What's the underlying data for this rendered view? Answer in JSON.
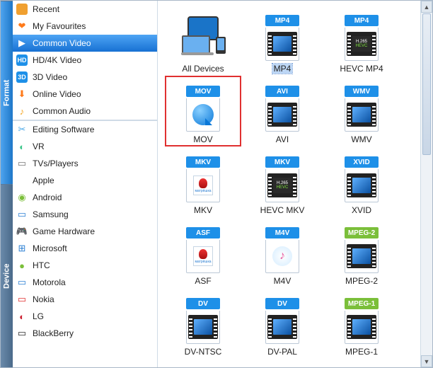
{
  "vtabs": {
    "format": "Format",
    "device": "Device"
  },
  "sidebar_top": [
    {
      "name": "recent",
      "label": "Recent",
      "iconType": "sq",
      "bg": "#f0a030",
      "glyph": ""
    },
    {
      "name": "favourites",
      "label": "My Favourites",
      "iconType": "glyph",
      "color": "#ff7a1a",
      "glyph": "❤"
    },
    {
      "name": "common-video",
      "label": "Common Video",
      "iconType": "glyph",
      "color": "#fff",
      "glyph": "▶",
      "selected": true
    },
    {
      "name": "hd4k",
      "label": "HD/4K Video",
      "iconType": "sq",
      "bg": "#1e90e8",
      "glyph": "HD"
    },
    {
      "name": "3d",
      "label": "3D Video",
      "iconType": "sq",
      "bg": "#1e90e8",
      "glyph": "3D"
    },
    {
      "name": "online",
      "label": "Online Video",
      "iconType": "glyph",
      "color": "#ff7a1a",
      "glyph": "⬇"
    },
    {
      "name": "audio",
      "label": "Common Audio",
      "iconType": "glyph",
      "color": "#f5a623",
      "glyph": "♪"
    }
  ],
  "sidebar_bottom": [
    {
      "name": "editing",
      "label": "Editing Software",
      "glyph": "✂",
      "color": "#4aa8e8"
    },
    {
      "name": "vr",
      "label": "VR",
      "glyph": "◐",
      "color": "#3fc68c"
    },
    {
      "name": "tvs",
      "label": "TVs/Players",
      "glyph": "▭",
      "color": "#777"
    },
    {
      "name": "apple",
      "label": "Apple",
      "glyph": "",
      "color": "#555"
    },
    {
      "name": "android",
      "label": "Android",
      "glyph": "◉",
      "color": "#7bbf3a"
    },
    {
      "name": "samsung",
      "label": "Samsung",
      "glyph": "▭",
      "color": "#2b7fd3"
    },
    {
      "name": "gamehw",
      "label": "Game Hardware",
      "glyph": "🎮",
      "color": "#555"
    },
    {
      "name": "microsoft",
      "label": "Microsoft",
      "glyph": "⊞",
      "color": "#2b7fd3"
    },
    {
      "name": "htc",
      "label": "HTC",
      "glyph": "●",
      "color": "#7bbf3a"
    },
    {
      "name": "motorola",
      "label": "Motorola",
      "glyph": "▭",
      "color": "#2b7fd3"
    },
    {
      "name": "nokia",
      "label": "Nokia",
      "glyph": "▭",
      "color": "#e03030"
    },
    {
      "name": "lg",
      "label": "LG",
      "glyph": "◐",
      "color": "#c23"
    },
    {
      "name": "blackberry",
      "label": "BlackBerry",
      "glyph": "▭",
      "color": "#2a2a2a"
    }
  ],
  "grid": [
    {
      "name": "all-devices",
      "label": "All Devices",
      "thumbType": "devices",
      "badge": "",
      "badgeColor": ""
    },
    {
      "name": "mp4",
      "label": "MP4",
      "thumbType": "film",
      "badge": "MP4",
      "badgeColor": "#1e90e8",
      "selected": true
    },
    {
      "name": "hevc-mp4",
      "label": "HEVC MP4",
      "thumbType": "film-dark",
      "badge": "MP4",
      "badgeColor": "#1e90e8",
      "darkText1": "H.265",
      "darkText2": "HEVC"
    },
    {
      "name": "mov",
      "label": "MOV",
      "thumbType": "qt",
      "badge": "MOV",
      "badgeColor": "#1e90e8",
      "highlight": true
    },
    {
      "name": "avi",
      "label": "AVI",
      "thumbType": "film",
      "badge": "AVI",
      "badgeColor": "#1e90e8"
    },
    {
      "name": "wmv",
      "label": "WMV",
      "thumbType": "film",
      "badge": "WMV",
      "badgeColor": "#1e90e8"
    },
    {
      "name": "mkv",
      "label": "MKV",
      "thumbType": "mkv",
      "badge": "MKV",
      "badgeColor": "#1e90e8"
    },
    {
      "name": "hevc-mkv",
      "label": "HEVC MKV",
      "thumbType": "film-dark",
      "badge": "MKV",
      "badgeColor": "#1e90e8",
      "darkText1": "H.265",
      "darkText2": "HEVC"
    },
    {
      "name": "xvid",
      "label": "XVID",
      "thumbType": "film",
      "badge": "XVID",
      "badgeColor": "#1e90e8"
    },
    {
      "name": "asf",
      "label": "ASF",
      "thumbType": "mkv",
      "badge": "ASF",
      "badgeColor": "#1e90e8"
    },
    {
      "name": "m4v",
      "label": "M4V",
      "thumbType": "itunes",
      "badge": "M4V",
      "badgeColor": "#1e90e8"
    },
    {
      "name": "mpeg2",
      "label": "MPEG-2",
      "thumbType": "film",
      "badge": "MPEG-2",
      "badgeColor": "#7bbf3a"
    },
    {
      "name": "dv-ntsc",
      "label": "DV-NTSC",
      "thumbType": "film",
      "badge": "DV",
      "badgeColor": "#1e90e8"
    },
    {
      "name": "dv-pal",
      "label": "DV-PAL",
      "thumbType": "film",
      "badge": "DV",
      "badgeColor": "#1e90e8"
    },
    {
      "name": "mpeg1",
      "label": "MPEG-1",
      "thumbType": "film",
      "badge": "MPEG-1",
      "badgeColor": "#7bbf3a"
    }
  ]
}
